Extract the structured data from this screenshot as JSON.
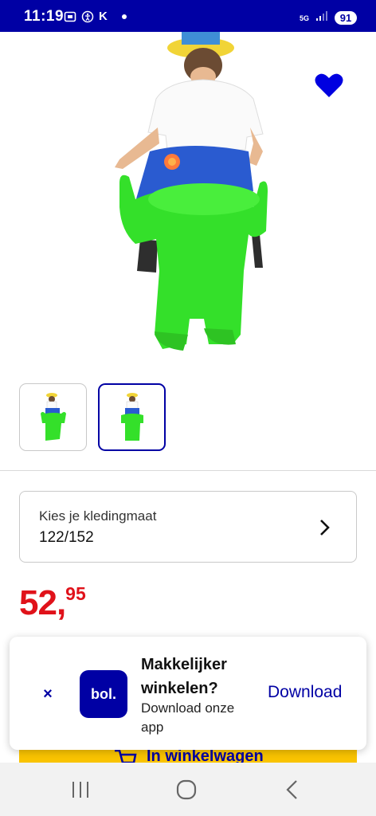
{
  "status_bar": {
    "time": "11:19",
    "carrier_letter": "K",
    "network": "5G",
    "battery": "91",
    "icons": [
      "screenshot-icon",
      "accessibility-icon",
      "signal-icon"
    ]
  },
  "product": {
    "image_desc_icon": "inflatable-costume-image",
    "favorite_icon": "heart-icon",
    "favorite_color": "#0000e0",
    "thumbnails": 2,
    "active_thumbnail": 2
  },
  "size_selector": {
    "label": "Kies je kledingmaat",
    "value": "122/152"
  },
  "price": {
    "main": "52,",
    "cents": "95"
  },
  "cart": {
    "label": "In winkelwagen"
  },
  "promo": {
    "logo_text": "bol.",
    "title": "Makkelijker winkelen?",
    "subtitle": "Download onze app",
    "download_label": "Download",
    "close_label": "×"
  },
  "colors": {
    "brand_blue": "#0000a4",
    "price_red": "#e0121a",
    "cart_yellow": "#f9c300"
  }
}
